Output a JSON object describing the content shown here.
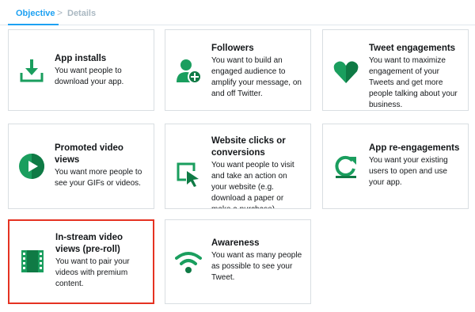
{
  "tabs": {
    "objective": "Objective",
    "separator": ">",
    "details": "Details"
  },
  "colors": {
    "accent": "#1da1f2",
    "icon_green": "#1a9e5e",
    "icon_green_dark": "#0f7a45",
    "selected_border": "#e53222"
  },
  "objectives": [
    {
      "title": "App installs",
      "description": "You want people to download your app.",
      "icon": "download-icon",
      "selected": false
    },
    {
      "title": "Followers",
      "description": "You want to build an engaged audience to amplify your message, on and off Twitter.",
      "icon": "add-user-icon",
      "selected": false
    },
    {
      "title": "Tweet engagements",
      "description": "You want to maximize engagement of your Tweets and get more people talking about your business.",
      "icon": "heart-icon",
      "selected": false
    },
    {
      "title": "Promoted video views",
      "description": "You want more people to see your GIFs or videos.",
      "icon": "play-icon",
      "selected": false
    },
    {
      "title": "Website clicks or conversions",
      "description": "You want people to visit and take an action on your website (e.g. download a paper or make a purchase).",
      "icon": "cursor-click-icon",
      "selected": false
    },
    {
      "title": "App re-engagements",
      "description": "You want your existing users to open and use your app.",
      "icon": "refresh-icon",
      "selected": false
    },
    {
      "title": "In-stream video views (pre-roll)",
      "description": "You want to pair your videos with premium content.",
      "icon": "film-icon",
      "selected": true
    },
    {
      "title": "Awareness",
      "description": "You want as many people as possible to see your Tweet.",
      "icon": "wifi-icon",
      "selected": false
    }
  ]
}
